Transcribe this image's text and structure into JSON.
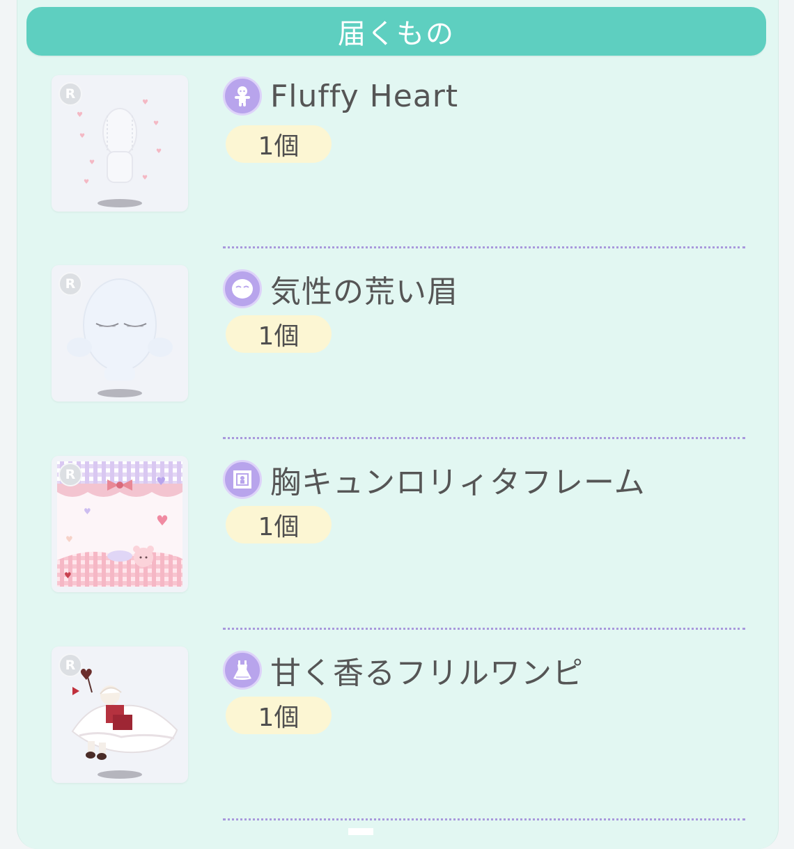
{
  "header": {
    "title": "届くもの"
  },
  "items": [
    {
      "rarity": "R",
      "category_icon": "avatar-body-icon",
      "name": "Fluffy Heart",
      "quantity": "1個"
    },
    {
      "rarity": "R",
      "category_icon": "face-eyebrow-icon",
      "name": "気性の荒い眉",
      "quantity": "1個"
    },
    {
      "rarity": "R",
      "category_icon": "frame-icon",
      "name": "胸キュンロリィタフレーム",
      "quantity": "1個"
    },
    {
      "rarity": "R",
      "category_icon": "dress-icon",
      "name": "甘く香るフリルワンピ",
      "quantity": "1個"
    }
  ],
  "colors": {
    "panel": "#e2f7f2",
    "header": "#5ecfc0",
    "badge": "#b8a4ec",
    "quantity_pill": "#fcf6d3",
    "divider": "#a898dc"
  }
}
